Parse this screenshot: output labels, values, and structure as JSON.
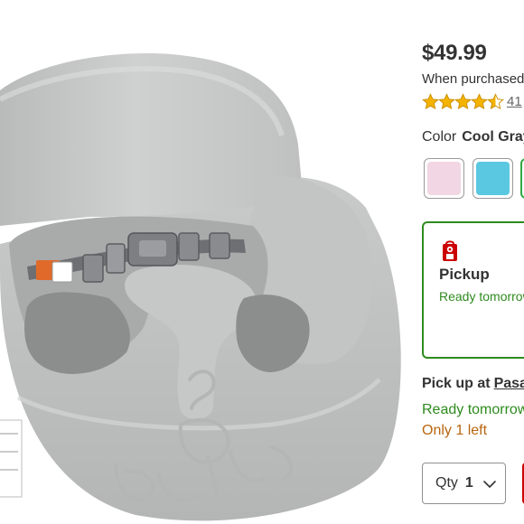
{
  "product": {
    "image_alt": "Cool Gray infant floor seat with harness",
    "embossed_logo": "Bumbo"
  },
  "price": {
    "amount": "$49.99",
    "note": "When purchased online"
  },
  "rating": {
    "stars_value": 4.5,
    "stars_max": 5,
    "count": "41"
  },
  "color": {
    "label": "Color",
    "value": "Cool Gray",
    "swatches": [
      {
        "name": "Pink",
        "hex": "#f2d6e3",
        "selected": false
      },
      {
        "name": "Blue",
        "hex": "#5bc8e2",
        "selected": false
      },
      {
        "name": "Cool Gray",
        "hex": "#c7c8c8",
        "selected": true
      }
    ]
  },
  "fulfillment": {
    "pickup_title": "Pickup",
    "pickup_status": "Ready tomorrow",
    "store_prefix": "Pick up at",
    "store_name": "Pasadena",
    "ready_text": "Ready tomorrow",
    "stock_text": "Only 1 left"
  },
  "quantity": {
    "label": "Qty",
    "value": "1"
  },
  "colors": {
    "accent_green": "#2e8b1e",
    "brand_red": "#cc0000",
    "stock_orange": "#b8660f"
  }
}
